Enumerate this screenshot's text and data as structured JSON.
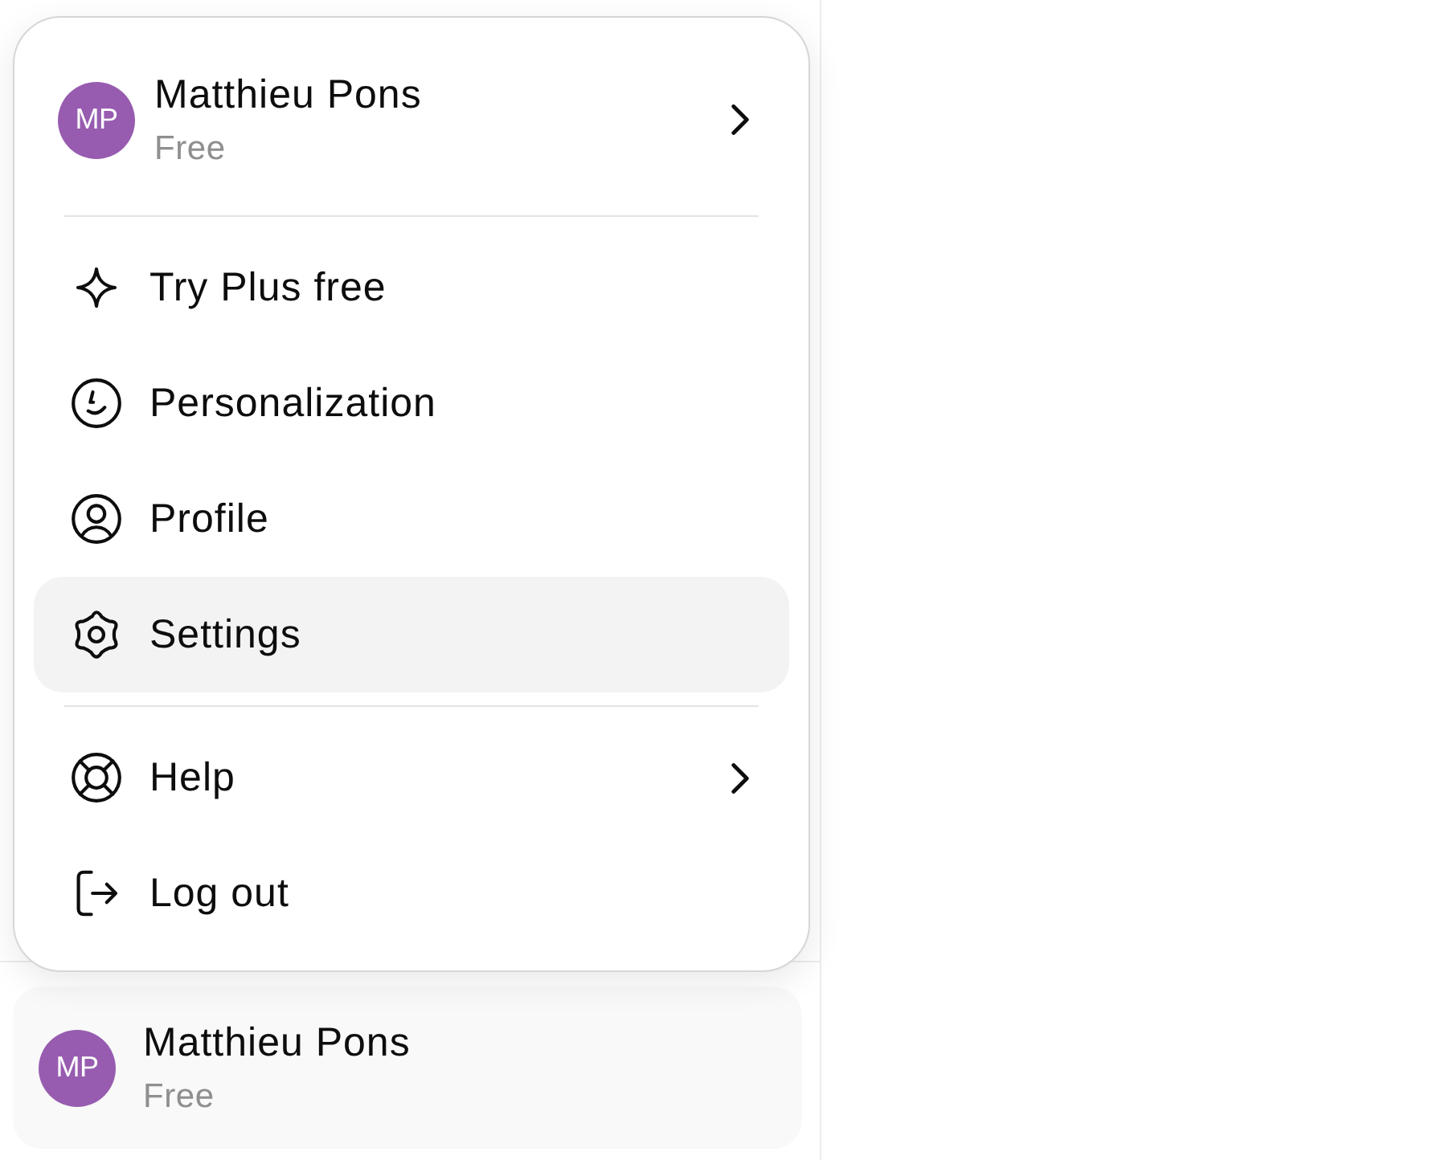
{
  "menu": {
    "account": {
      "avatar_initials": "MP",
      "name": "Matthieu Pons",
      "plan": "Free",
      "has_submenu": true
    },
    "sections": [
      {
        "items": [
          {
            "label": "Try Plus free",
            "selected": false,
            "has_submenu": false
          },
          {
            "label": "Personalization",
            "selected": false,
            "has_submenu": false
          },
          {
            "label": "Profile",
            "selected": false,
            "has_submenu": false
          },
          {
            "label": "Settings",
            "selected": true,
            "has_submenu": false
          }
        ]
      },
      {
        "items": [
          {
            "label": "Help",
            "selected": false,
            "has_submenu": true
          },
          {
            "label": "Log out",
            "selected": false,
            "has_submenu": false
          }
        ]
      }
    ]
  },
  "sidebar": {
    "user": {
      "avatar_initials": "MP",
      "name": "Matthieu Pons",
      "plan": "Free"
    }
  }
}
